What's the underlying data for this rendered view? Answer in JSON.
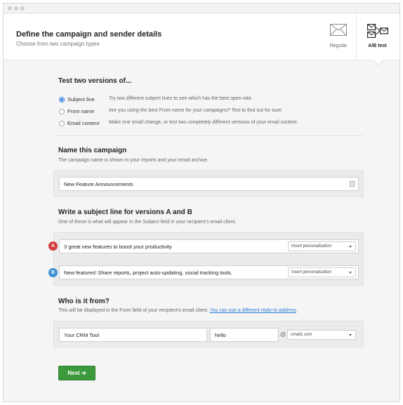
{
  "header": {
    "title": "Define the campaign and sender details",
    "subtitle": "Choose from two campaign types",
    "types": [
      {
        "label": "Regular",
        "icon": "envelope-icon"
      },
      {
        "label": "A/B test",
        "icon": "ab-test-icon",
        "selected": true
      }
    ]
  },
  "test_versions": {
    "title": "Test two versions of...",
    "options": [
      {
        "label": "Subject line",
        "description": "Try two different subject lines to see which has the best open rate.",
        "selected": true
      },
      {
        "label": "From name",
        "description": "Are you using the best From name for your campaigns? Test to find out for sure.",
        "selected": false
      },
      {
        "label": "Email content",
        "description": "Make one small change, or test two completely different versions of your email content.",
        "selected": false
      }
    ]
  },
  "campaign_name": {
    "title": "Name this campaign",
    "description": "The campaign name is shown in your reports and your email archive.",
    "value": "New Feature Announcements"
  },
  "subject_lines": {
    "title": "Write a subject line for versions A and B",
    "description": "One of these is what will appear in the Subject field in your recipient's email client.",
    "versions": [
      {
        "badge": "A",
        "value": "3 great new features to boost your productivity",
        "personalization": "Insert personalization",
        "color": "#d23b3b"
      },
      {
        "badge": "B",
        "value": "New features! Share reports, project auto-updating, social tracking tools.",
        "personalization": "Insert personalization",
        "color": "#3b8fd2"
      }
    ]
  },
  "sender": {
    "title": "Who is it from?",
    "description": "This will be displayed in the From field of your recipient's email client.",
    "link": "You can use a different reply-to address",
    "link_suffix": ".",
    "from_name": "Your CRM Tool",
    "email_local": "hello",
    "at": "@",
    "domain": "cmail1.com"
  },
  "actions": {
    "next": "Next ➔"
  },
  "colors": {
    "accent": "#2a7cd6",
    "next_button": "#3c9a3c"
  }
}
